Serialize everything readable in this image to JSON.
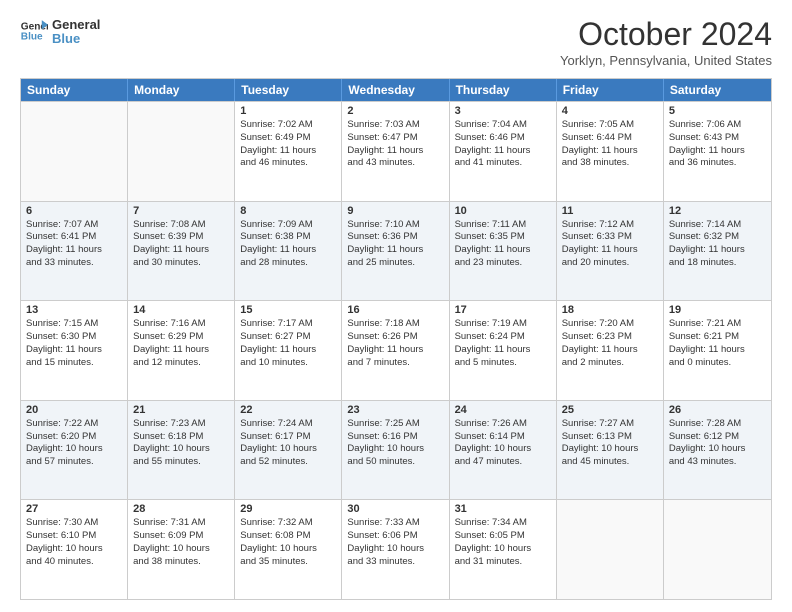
{
  "header": {
    "logo_line1": "General",
    "logo_line2": "Blue",
    "month": "October 2024",
    "location": "Yorklyn, Pennsylvania, United States"
  },
  "days_of_week": [
    "Sunday",
    "Monday",
    "Tuesday",
    "Wednesday",
    "Thursday",
    "Friday",
    "Saturday"
  ],
  "rows": [
    [
      {
        "day": "",
        "lines": [],
        "empty": true
      },
      {
        "day": "",
        "lines": [],
        "empty": true
      },
      {
        "day": "1",
        "lines": [
          "Sunrise: 7:02 AM",
          "Sunset: 6:49 PM",
          "Daylight: 11 hours",
          "and 46 minutes."
        ]
      },
      {
        "day": "2",
        "lines": [
          "Sunrise: 7:03 AM",
          "Sunset: 6:47 PM",
          "Daylight: 11 hours",
          "and 43 minutes."
        ]
      },
      {
        "day": "3",
        "lines": [
          "Sunrise: 7:04 AM",
          "Sunset: 6:46 PM",
          "Daylight: 11 hours",
          "and 41 minutes."
        ]
      },
      {
        "day": "4",
        "lines": [
          "Sunrise: 7:05 AM",
          "Sunset: 6:44 PM",
          "Daylight: 11 hours",
          "and 38 minutes."
        ]
      },
      {
        "day": "5",
        "lines": [
          "Sunrise: 7:06 AM",
          "Sunset: 6:43 PM",
          "Daylight: 11 hours",
          "and 36 minutes."
        ]
      }
    ],
    [
      {
        "day": "6",
        "lines": [
          "Sunrise: 7:07 AM",
          "Sunset: 6:41 PM",
          "Daylight: 11 hours",
          "and 33 minutes."
        ]
      },
      {
        "day": "7",
        "lines": [
          "Sunrise: 7:08 AM",
          "Sunset: 6:39 PM",
          "Daylight: 11 hours",
          "and 30 minutes."
        ]
      },
      {
        "day": "8",
        "lines": [
          "Sunrise: 7:09 AM",
          "Sunset: 6:38 PM",
          "Daylight: 11 hours",
          "and 28 minutes."
        ]
      },
      {
        "day": "9",
        "lines": [
          "Sunrise: 7:10 AM",
          "Sunset: 6:36 PM",
          "Daylight: 11 hours",
          "and 25 minutes."
        ]
      },
      {
        "day": "10",
        "lines": [
          "Sunrise: 7:11 AM",
          "Sunset: 6:35 PM",
          "Daylight: 11 hours",
          "and 23 minutes."
        ]
      },
      {
        "day": "11",
        "lines": [
          "Sunrise: 7:12 AM",
          "Sunset: 6:33 PM",
          "Daylight: 11 hours",
          "and 20 minutes."
        ]
      },
      {
        "day": "12",
        "lines": [
          "Sunrise: 7:14 AM",
          "Sunset: 6:32 PM",
          "Daylight: 11 hours",
          "and 18 minutes."
        ]
      }
    ],
    [
      {
        "day": "13",
        "lines": [
          "Sunrise: 7:15 AM",
          "Sunset: 6:30 PM",
          "Daylight: 11 hours",
          "and 15 minutes."
        ]
      },
      {
        "day": "14",
        "lines": [
          "Sunrise: 7:16 AM",
          "Sunset: 6:29 PM",
          "Daylight: 11 hours",
          "and 12 minutes."
        ]
      },
      {
        "day": "15",
        "lines": [
          "Sunrise: 7:17 AM",
          "Sunset: 6:27 PM",
          "Daylight: 11 hours",
          "and 10 minutes."
        ]
      },
      {
        "day": "16",
        "lines": [
          "Sunrise: 7:18 AM",
          "Sunset: 6:26 PM",
          "Daylight: 11 hours",
          "and 7 minutes."
        ]
      },
      {
        "day": "17",
        "lines": [
          "Sunrise: 7:19 AM",
          "Sunset: 6:24 PM",
          "Daylight: 11 hours",
          "and 5 minutes."
        ]
      },
      {
        "day": "18",
        "lines": [
          "Sunrise: 7:20 AM",
          "Sunset: 6:23 PM",
          "Daylight: 11 hours",
          "and 2 minutes."
        ]
      },
      {
        "day": "19",
        "lines": [
          "Sunrise: 7:21 AM",
          "Sunset: 6:21 PM",
          "Daylight: 11 hours",
          "and 0 minutes."
        ]
      }
    ],
    [
      {
        "day": "20",
        "lines": [
          "Sunrise: 7:22 AM",
          "Sunset: 6:20 PM",
          "Daylight: 10 hours",
          "and 57 minutes."
        ]
      },
      {
        "day": "21",
        "lines": [
          "Sunrise: 7:23 AM",
          "Sunset: 6:18 PM",
          "Daylight: 10 hours",
          "and 55 minutes."
        ]
      },
      {
        "day": "22",
        "lines": [
          "Sunrise: 7:24 AM",
          "Sunset: 6:17 PM",
          "Daylight: 10 hours",
          "and 52 minutes."
        ]
      },
      {
        "day": "23",
        "lines": [
          "Sunrise: 7:25 AM",
          "Sunset: 6:16 PM",
          "Daylight: 10 hours",
          "and 50 minutes."
        ]
      },
      {
        "day": "24",
        "lines": [
          "Sunrise: 7:26 AM",
          "Sunset: 6:14 PM",
          "Daylight: 10 hours",
          "and 47 minutes."
        ]
      },
      {
        "day": "25",
        "lines": [
          "Sunrise: 7:27 AM",
          "Sunset: 6:13 PM",
          "Daylight: 10 hours",
          "and 45 minutes."
        ]
      },
      {
        "day": "26",
        "lines": [
          "Sunrise: 7:28 AM",
          "Sunset: 6:12 PM",
          "Daylight: 10 hours",
          "and 43 minutes."
        ]
      }
    ],
    [
      {
        "day": "27",
        "lines": [
          "Sunrise: 7:30 AM",
          "Sunset: 6:10 PM",
          "Daylight: 10 hours",
          "and 40 minutes."
        ]
      },
      {
        "day": "28",
        "lines": [
          "Sunrise: 7:31 AM",
          "Sunset: 6:09 PM",
          "Daylight: 10 hours",
          "and 38 minutes."
        ]
      },
      {
        "day": "29",
        "lines": [
          "Sunrise: 7:32 AM",
          "Sunset: 6:08 PM",
          "Daylight: 10 hours",
          "and 35 minutes."
        ]
      },
      {
        "day": "30",
        "lines": [
          "Sunrise: 7:33 AM",
          "Sunset: 6:06 PM",
          "Daylight: 10 hours",
          "and 33 minutes."
        ]
      },
      {
        "day": "31",
        "lines": [
          "Sunrise: 7:34 AM",
          "Sunset: 6:05 PM",
          "Daylight: 10 hours",
          "and 31 minutes."
        ]
      },
      {
        "day": "",
        "lines": [],
        "empty": true
      },
      {
        "day": "",
        "lines": [],
        "empty": true
      }
    ]
  ],
  "alt_rows": [
    1,
    3
  ]
}
